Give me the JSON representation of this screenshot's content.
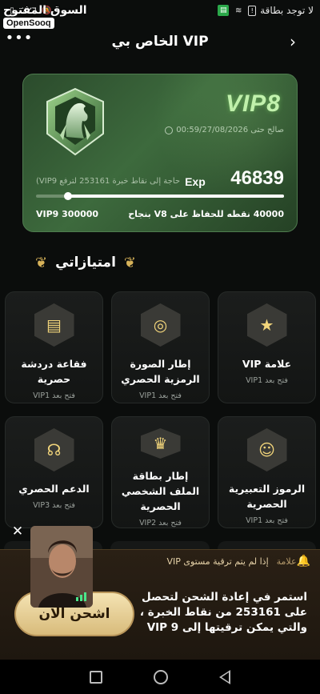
{
  "status_bar": {
    "carrier_text": "لا توجد بطاقة",
    "battery": "٪٢٦",
    "icons": [
      "carrier-icon",
      "sim-icon",
      "wifi-icon",
      "mute-icon",
      "battery-icon"
    ]
  },
  "watermark": {
    "arabic": "السوق المفتوح",
    "english": "OpenSooq"
  },
  "header": {
    "title": "الخاص بي VIP",
    "back_icon": "›",
    "more_icon": "•••"
  },
  "vip_card": {
    "level": "VIP8",
    "valid_until": "صالح حتى 00:59/27/08/2026",
    "exp_value": "46839",
    "exp_label": "Exp",
    "exp_needed": "حاجة إلى نقاط خبرة 253161 لترفع VIP9)",
    "progress_fraction": 0.13,
    "next_level": "VIP9 300000",
    "keep_text": "40000 نقطه للحفاظ على V8 بنجاح",
    "accent_color": "#c9f7b4"
  },
  "privileges": {
    "title": "امتيازاتي",
    "items": [
      {
        "name": "علامة VIP",
        "unlock": "فتح بعد VIP1",
        "icon": "badge-icon"
      },
      {
        "name": "إطار الصورة الرمزية الحصري",
        "unlock": "فتح بعد VIP1",
        "icon": "avatar-frame-icon"
      },
      {
        "name": "فقاعة دردشة حصرية",
        "unlock": "فتح بعد VIP1",
        "icon": "chat-bubble-icon"
      },
      {
        "name": "الرموز التعبيرية الحصرية",
        "unlock": "فتح بعد VIP1",
        "icon": "emoji-icon"
      },
      {
        "name": "إطار بطاقة الملف الشخصي الحصرية",
        "unlock": "فتح بعد VIP2",
        "icon": "profile-card-icon"
      },
      {
        "name": "الدعم الحصري",
        "unlock": "فتح بعد VIP3",
        "icon": "headset-icon"
      }
    ]
  },
  "promo": {
    "notice_tag": "علامة",
    "notice_text": "إذا لم يتم ترقية مستوى VIP",
    "message": "استمر في إعادة الشحن لتحصل على 253161 من نقاط الخبرة ، والتي يمكن ترقيتها إلى VIP 9",
    "button": "اشحن الان",
    "button_color": "#e8cf94"
  }
}
